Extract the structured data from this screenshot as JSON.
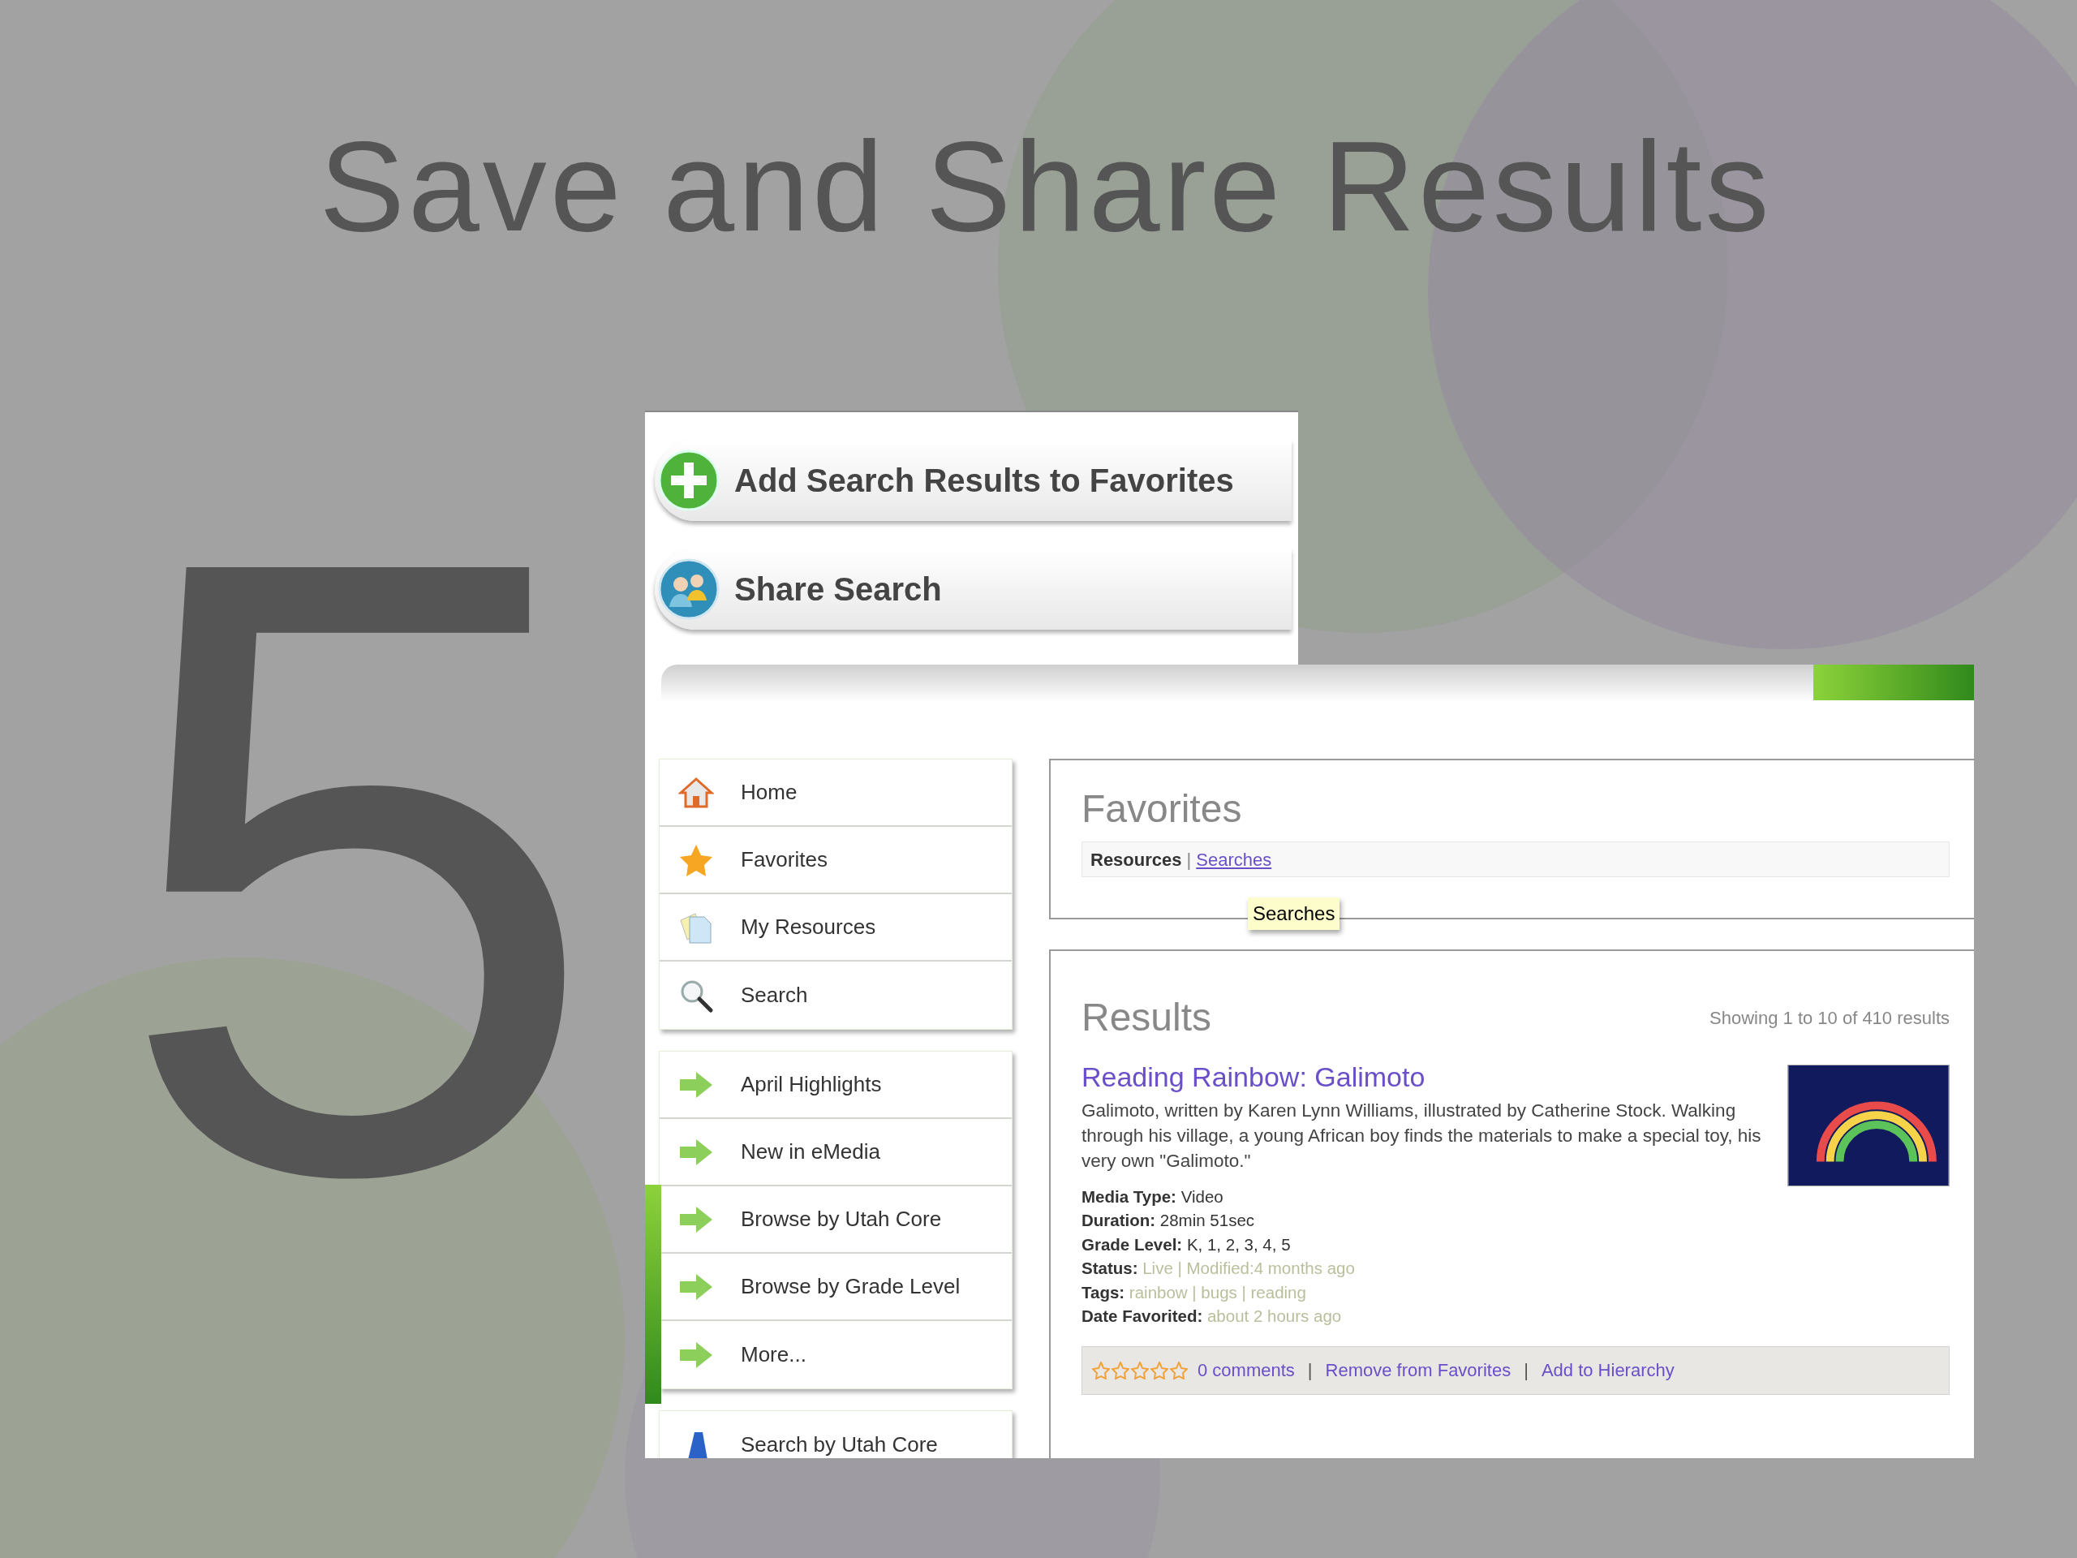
{
  "slide": {
    "title": "Save and Share Results",
    "number": "5"
  },
  "actions": [
    {
      "label": "Add Search Results to Favorites",
      "kind": "add"
    },
    {
      "label": "Share Search",
      "kind": "share"
    }
  ],
  "sidebar": {
    "groups": [
      {
        "items": [
          {
            "label": "Home",
            "kind": "home"
          },
          {
            "label": "Favorites",
            "kind": "star"
          },
          {
            "label": "My Resources",
            "kind": "documents"
          },
          {
            "label": "Search",
            "kind": "search"
          }
        ]
      },
      {
        "items": [
          {
            "label": "April Highlights",
            "kind": "arrow"
          },
          {
            "label": "New in eMedia",
            "kind": "arrow"
          },
          {
            "label": "Browse by Utah Core",
            "kind": "arrow"
          },
          {
            "label": "Browse by Grade Level",
            "kind": "arrow"
          },
          {
            "label": "More...",
            "kind": "arrow"
          }
        ]
      },
      {
        "items": [
          {
            "label": "Search by Utah Core",
            "kind": "core"
          }
        ]
      }
    ]
  },
  "favorites": {
    "heading": "Favorites",
    "tabs": [
      {
        "label": "Resources",
        "selected": true
      },
      {
        "label": "Searches",
        "selected": false
      }
    ],
    "separator": "|",
    "tooltip": "Searches"
  },
  "results": {
    "heading": "Results",
    "count": "Showing 1 to 10 of 410 results",
    "items": [
      {
        "title": "Reading Rainbow: Galimoto",
        "description": "Galimoto, written by Karen Lynn Williams, illustrated by Catherine Stock. Walking through his village, a young African boy finds the materials to make a special toy, his very own \"Galimoto.\"",
        "fields": [
          {
            "label": "Media Type:",
            "value": "Video",
            "kind": "plain"
          },
          {
            "label": "Duration:",
            "value": "28min 51sec",
            "kind": "plain"
          },
          {
            "label": "Grade Level:",
            "value": "K, 1, 2, 3, 4, 5",
            "kind": "plain"
          },
          {
            "label": "Status:",
            "value": "Live | Modified:4 months ago",
            "kind": "muted"
          },
          {
            "label": "Tags:",
            "value": "rainbow | bugs | reading",
            "kind": "muted"
          },
          {
            "label": "Date Favorited:",
            "value": "about 2 hours ago",
            "kind": "muted"
          }
        ],
        "stars": 0,
        "separator": "|",
        "links": [
          "0 comments",
          "Remove from Favorites",
          "Add to Hierarchy"
        ]
      }
    ]
  }
}
